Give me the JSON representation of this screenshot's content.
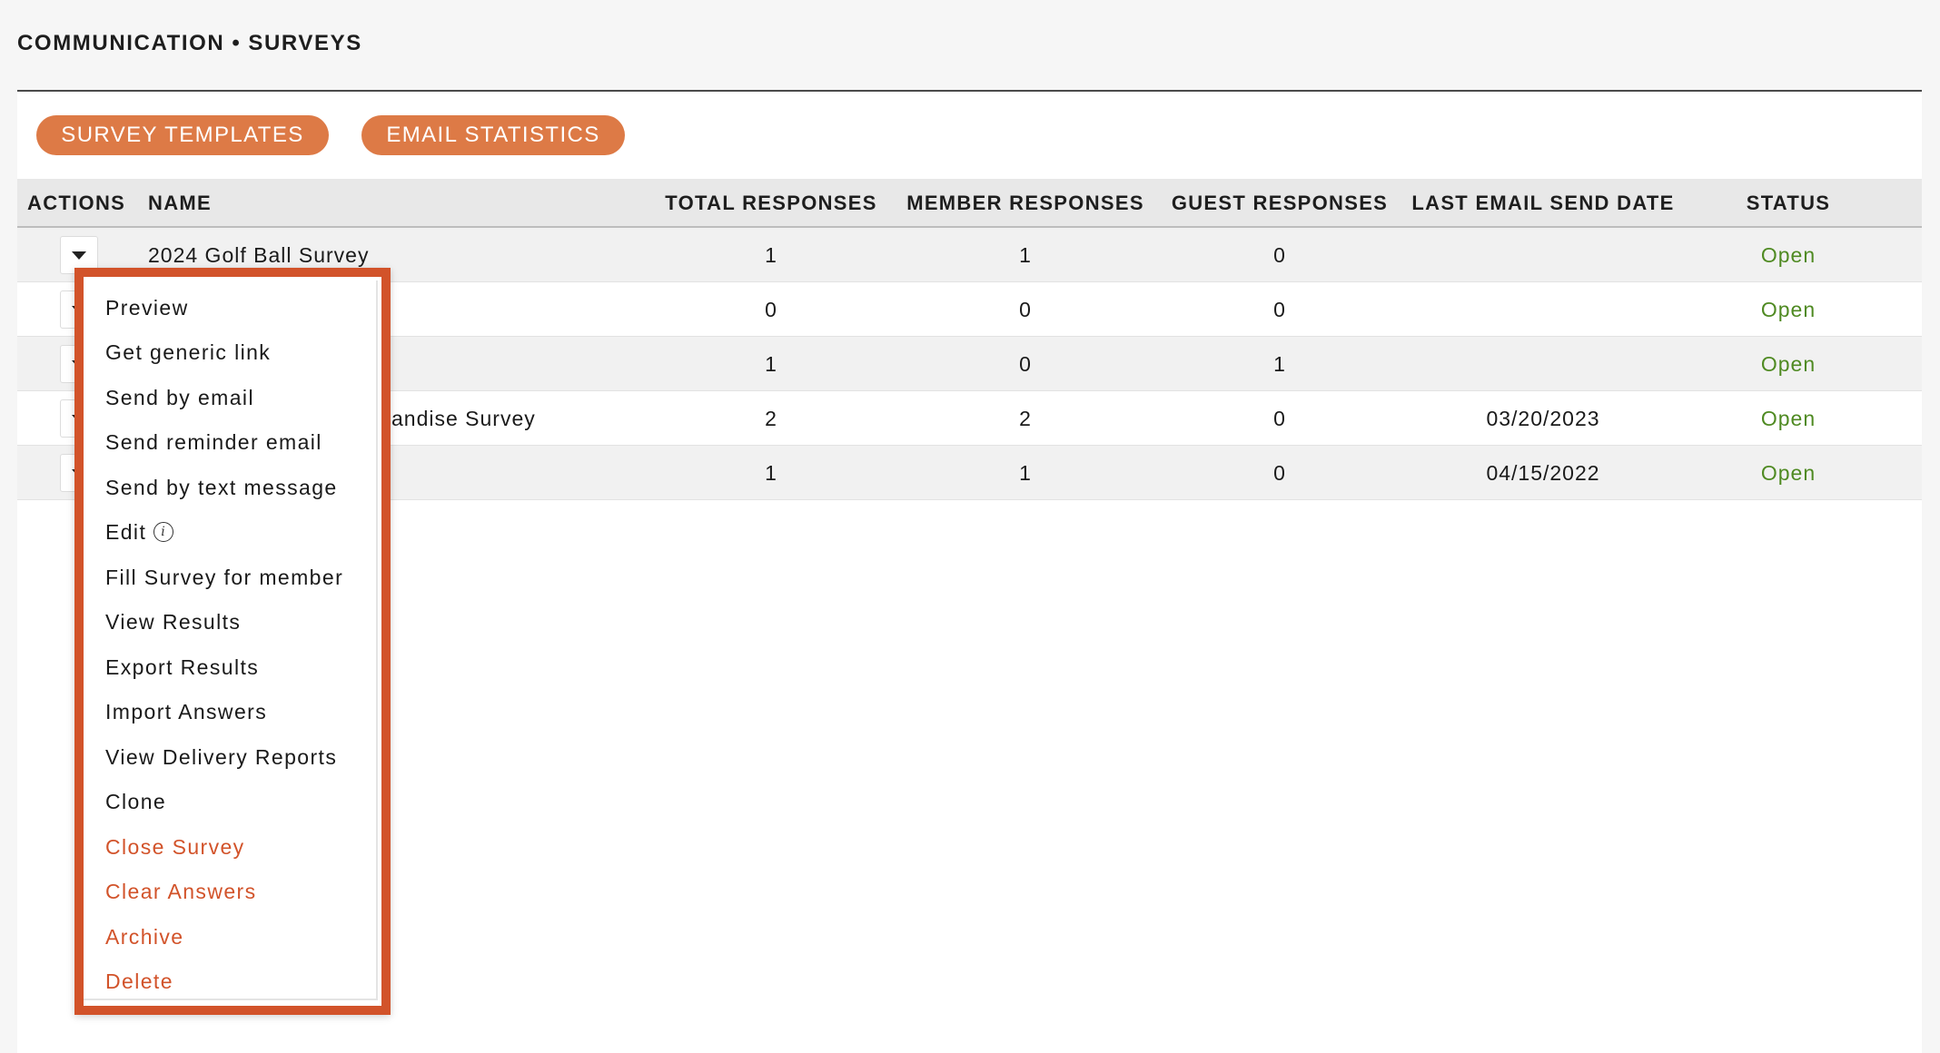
{
  "breadcrumb": {
    "section": "COMMUNICATION",
    "separator": "•",
    "page": "SURVEYS"
  },
  "toolbar": {
    "survey_templates_label": "SURVEY TEMPLATES",
    "email_statistics_label": "EMAIL STATISTICS"
  },
  "colors": {
    "accent": "#dd7a46",
    "danger": "#d2532a",
    "status_open": "#4f8a22"
  },
  "table": {
    "headers": {
      "actions": "ACTIONS",
      "name": "NAME",
      "total_responses": "TOTAL RESPONSES",
      "member_responses": "MEMBER RESPONSES",
      "guest_responses": "GUEST RESPONSES",
      "last_email_send_date": "LAST EMAIL SEND DATE",
      "status": "STATUS"
    },
    "rows": [
      {
        "name": "2024 Golf Ball Survey",
        "total": "1",
        "member": "1",
        "guest": "0",
        "last_email": "",
        "status": "Open"
      },
      {
        "name": "",
        "total": "0",
        "member": "0",
        "guest": "0",
        "last_email": "",
        "status": "Open"
      },
      {
        "name": "",
        "total": "1",
        "member": "0",
        "guest": "1",
        "last_email": "",
        "status": "Open"
      },
      {
        "name": "andise Survey",
        "total": "2",
        "member": "2",
        "guest": "0",
        "last_email": "03/20/2023",
        "status": "Open"
      },
      {
        "name": "",
        "total": "1",
        "member": "1",
        "guest": "0",
        "last_email": "04/15/2022",
        "status": "Open"
      }
    ]
  },
  "actions_menu": {
    "items": [
      {
        "label": "Preview"
      },
      {
        "label": "Get generic link"
      },
      {
        "label": "Send by email"
      },
      {
        "label": "Send reminder email"
      },
      {
        "label": "Send by text message"
      },
      {
        "label": "Edit"
      },
      {
        "label": "Fill Survey for member"
      },
      {
        "label": "View Results"
      },
      {
        "label": "Export Results"
      },
      {
        "label": "Import Answers"
      },
      {
        "label": "View Delivery Reports"
      },
      {
        "label": "Clone"
      },
      {
        "label": "Close Survey"
      },
      {
        "label": "Clear Answers"
      },
      {
        "label": "Archive"
      },
      {
        "label": "Delete"
      }
    ],
    "edit_info_icon": "info-icon"
  }
}
